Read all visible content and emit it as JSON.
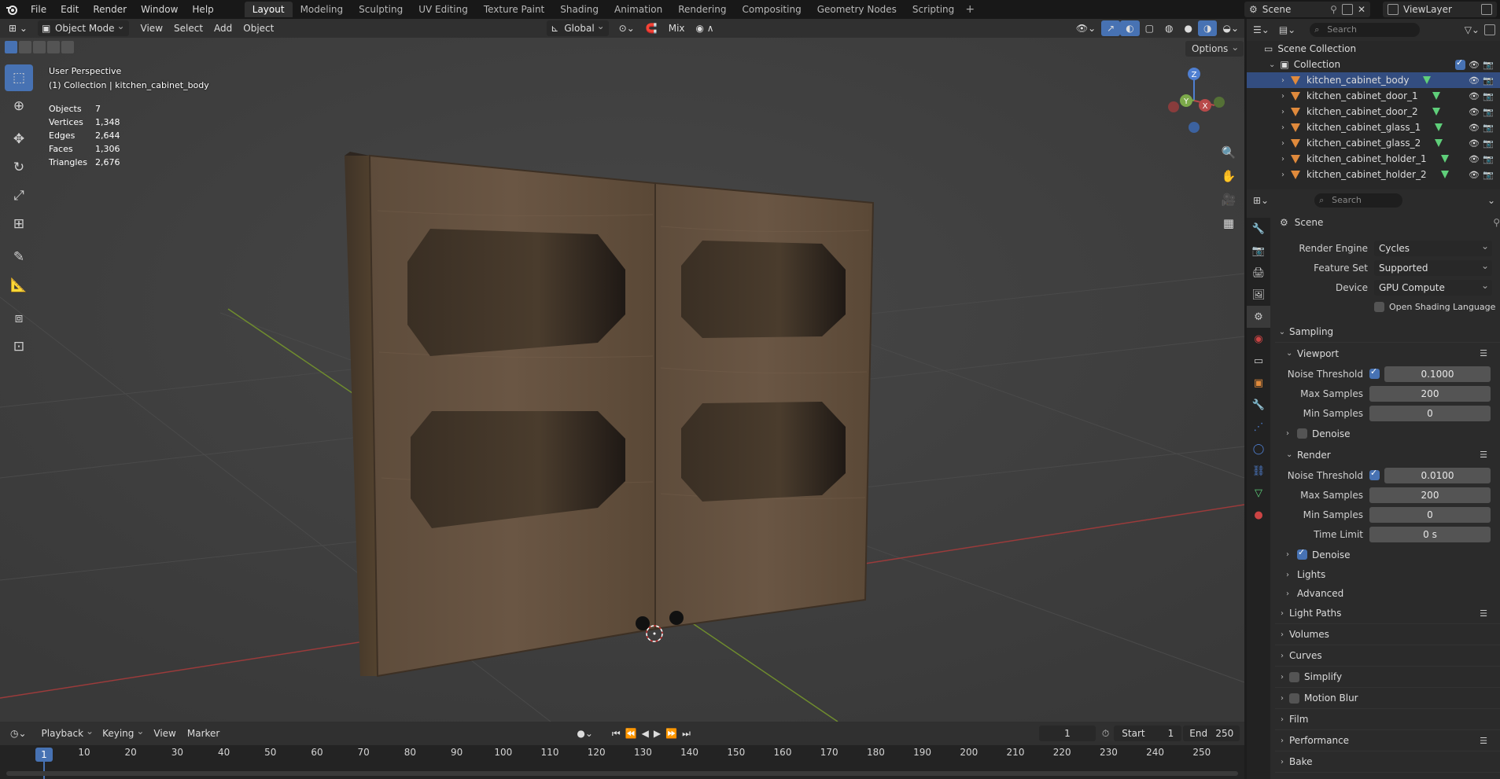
{
  "topbar": {
    "menus": [
      "File",
      "Edit",
      "Render",
      "Window",
      "Help"
    ],
    "workspaces": [
      "Layout",
      "Modeling",
      "Sculpting",
      "UV Editing",
      "Texture Paint",
      "Shading",
      "Animation",
      "Rendering",
      "Compositing",
      "Geometry Nodes",
      "Scripting"
    ],
    "active_workspace": "Layout",
    "scene": "Scene",
    "view_layer": "ViewLayer"
  },
  "viewport_header": {
    "mode": "Object Mode",
    "menus": [
      "View",
      "Select",
      "Add",
      "Object"
    ],
    "orientation": "Global",
    "snap_mode": "Mix",
    "options": "Options"
  },
  "viewport": {
    "perspective": "User Perspective",
    "collection_line": "(1) Collection | kitchen_cabinet_body",
    "stats": [
      {
        "label": "Objects",
        "value": "7"
      },
      {
        "label": "Vertices",
        "value": "1,348"
      },
      {
        "label": "Edges",
        "value": "2,644"
      },
      {
        "label": "Faces",
        "value": "1,306"
      },
      {
        "label": "Triangles",
        "value": "2,676"
      }
    ],
    "gizmo_labels": {
      "z": "Z",
      "y": "Y",
      "x": "X"
    }
  },
  "timeline": {
    "menus": [
      "Playback",
      "Keying",
      "View",
      "Marker"
    ],
    "current_frame": "1",
    "start_label": "Start",
    "start": "1",
    "end_label": "End",
    "end": "250",
    "marks": [
      "10",
      "20",
      "30",
      "40",
      "50",
      "60",
      "70",
      "80",
      "90",
      "100",
      "110",
      "120",
      "130",
      "140",
      "150",
      "160",
      "170",
      "180",
      "190",
      "200",
      "210",
      "220",
      "230",
      "240",
      "250"
    ]
  },
  "outliner": {
    "search_placeholder": "Search",
    "root": "Scene Collection",
    "collection": "Collection",
    "objects": [
      "kitchen_cabinet_body",
      "kitchen_cabinet_door_1",
      "kitchen_cabinet_door_2",
      "kitchen_cabinet_glass_1",
      "kitchen_cabinet_glass_2",
      "kitchen_cabinet_holder_1",
      "kitchen_cabinet_holder_2"
    ],
    "selected": "kitchen_cabinet_body"
  },
  "properties": {
    "search_placeholder": "Search",
    "context": "Scene",
    "render_engine_label": "Render Engine",
    "render_engine": "Cycles",
    "feature_set_label": "Feature Set",
    "feature_set": "Supported",
    "device_label": "Device",
    "device": "GPU Compute",
    "osl_label": "Open Shading Language",
    "sampling": "Sampling",
    "viewport": "Viewport",
    "vp_noise_label": "Noise Threshold",
    "vp_noise": "0.1000",
    "vp_max_label": "Max Samples",
    "vp_max": "200",
    "vp_min_label": "Min Samples",
    "vp_min": "0",
    "vp_denoise": "Denoise",
    "render": "Render",
    "r_noise_label": "Noise Threshold",
    "r_noise": "0.0100",
    "r_max_label": "Max Samples",
    "r_max": "200",
    "r_min_label": "Min Samples",
    "r_min": "0",
    "r_time_label": "Time Limit",
    "r_time": "0 s",
    "r_denoise": "Denoise",
    "lights": "Lights",
    "advanced": "Advanced",
    "panels": [
      "Light Paths",
      "Volumes",
      "Curves",
      "Simplify",
      "Motion Blur",
      "Film",
      "Performance",
      "Bake"
    ]
  },
  "colors": {
    "accent": "#4772b3",
    "selection": "#334d80",
    "mesh_icon": "#e08a3c",
    "data_icon": "#5fcf7a"
  }
}
